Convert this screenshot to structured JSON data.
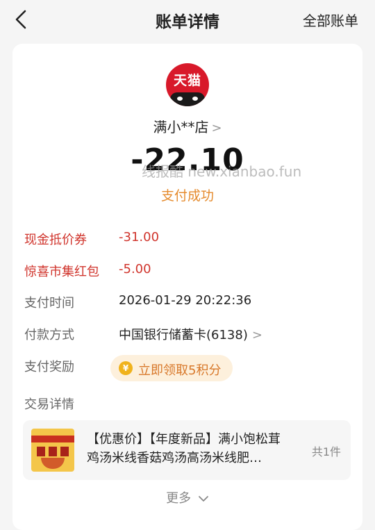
{
  "nav": {
    "title": "账单详情",
    "right_label": "全部账单",
    "back_icon": "chevron-left-icon"
  },
  "merchant": {
    "logo_text": "天猫",
    "name": "满小**店",
    "chevron": ">"
  },
  "amount": "-22.10",
  "watermark": "线报酷 new.xianbao.fun",
  "status": "支付成功",
  "details": [
    {
      "label": "现金抵价券",
      "value": "-31.00"
    },
    {
      "label": "惊喜市集红包",
      "value": "-5.00"
    },
    {
      "label": "支付时间",
      "value": "2026-01-29 20:22:36"
    },
    {
      "label": "付款方式",
      "value": "中国银行储蓄卡(6138)",
      "chevron": ">"
    }
  ],
  "reward": {
    "label": "支付奖励",
    "coin_icon": "coin-icon",
    "coin_symbol": "¥",
    "text": "立即领取5积分"
  },
  "trade": {
    "label": "交易详情",
    "product_title": "【优惠价】【年度新品】满小饱松茸鸡汤米线香菇鸡汤高汤米线肥…",
    "count": "共1件"
  },
  "more": {
    "label": "更多",
    "icon": "chevron-down-icon"
  },
  "colors": {
    "discount_red": "#d0342c",
    "status_orange": "#e58a2c",
    "tmall_red": "#d8192a",
    "reward_bg": "#fdf0dc"
  }
}
